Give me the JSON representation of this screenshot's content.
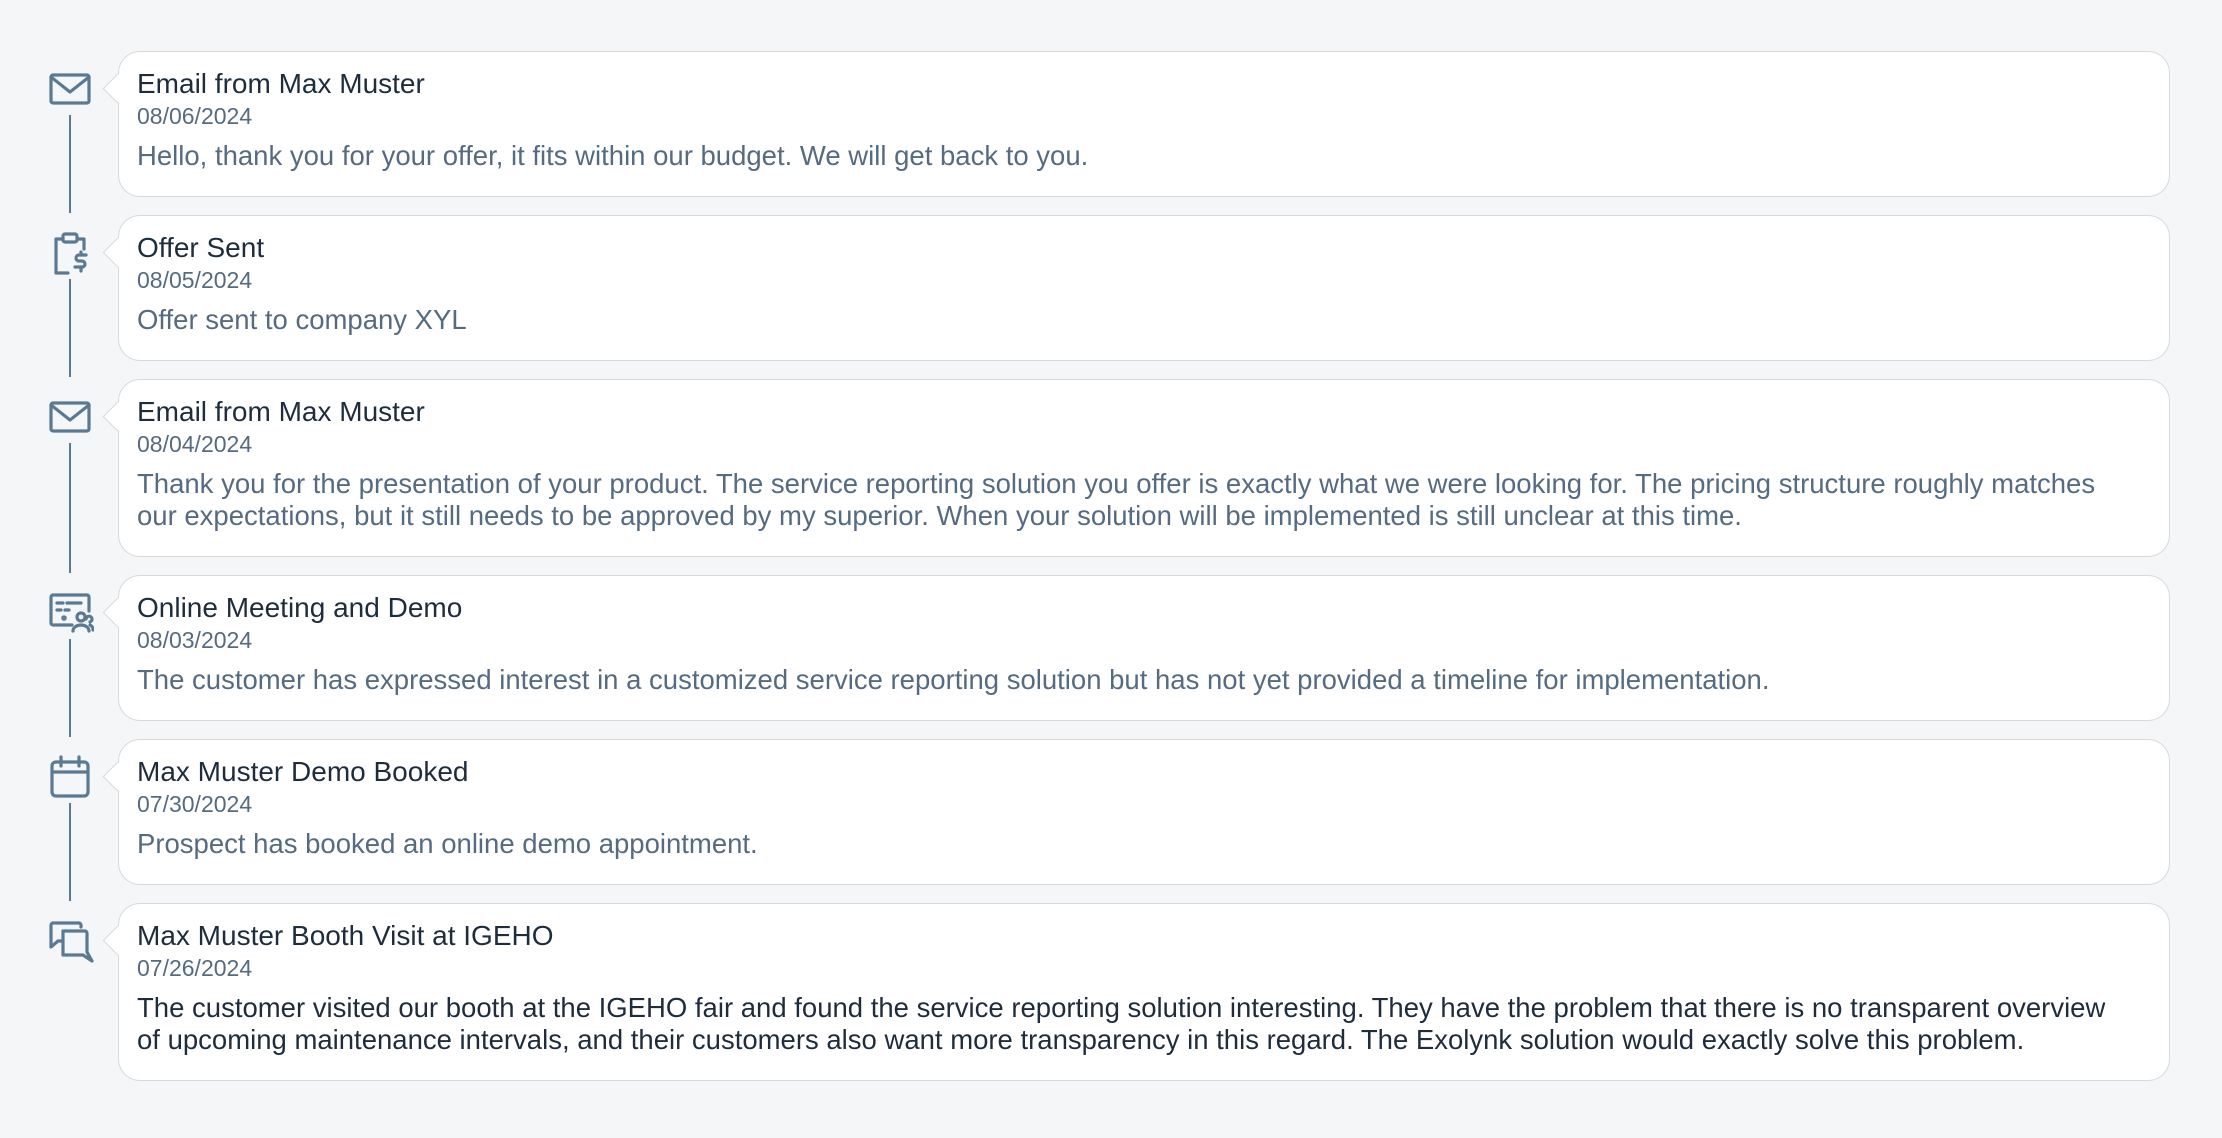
{
  "timeline": {
    "items": [
      {
        "icon": "envelope-icon",
        "title": "Email from Max Muster",
        "date": "08/06/2024",
        "text": [
          "Hello, thank you for your offer, it fits within our budget. We will get back to you."
        ]
      },
      {
        "icon": "clipboard-dollar-icon",
        "title": "Offer Sent",
        "date": "08/05/2024",
        "text": [
          "Offer sent to company XYL"
        ]
      },
      {
        "icon": "envelope-icon",
        "title": "Email from Max Muster",
        "date": "08/04/2024",
        "text": [
          "Thank you for the presentation of your product. The service reporting solution you offer is exactly what we were looking for. The pricing structure roughly matches",
          "our expectations, but it still needs to be approved by my superior. When your solution will be implemented is still unclear at this time."
        ]
      },
      {
        "icon": "online-meeting-icon",
        "title": "Online Meeting and Demo",
        "date": "08/03/2024",
        "text": [
          "The customer has expressed interest in a customized service reporting solution but has not yet provided a timeline for implementation."
        ]
      },
      {
        "icon": "calendar-icon",
        "title": "Max Muster Demo Booked",
        "date": "07/30/2024",
        "text": [
          "Prospect has booked an online demo appointment."
        ]
      },
      {
        "icon": "discussion-icon",
        "title": "Max Muster Booth Visit at IGEHO",
        "date": "07/26/2024",
        "text": [
          "The customer visited our booth at the IGEHO fair and found the service reporting solution interesting. They have the problem that there is no transparent overview",
          "of upcoming maintenance intervals, and their customers also want more transparency in this regard. The Exolynk solution would exactly solve this problem."
        ]
      }
    ]
  },
  "colors": {
    "background": "#f5f6f7",
    "card": "#ffffff",
    "card_border": "#d5dadd",
    "icon": "#5a7a94",
    "title_text": "#1d2d3e",
    "body_text": "#556b82"
  }
}
